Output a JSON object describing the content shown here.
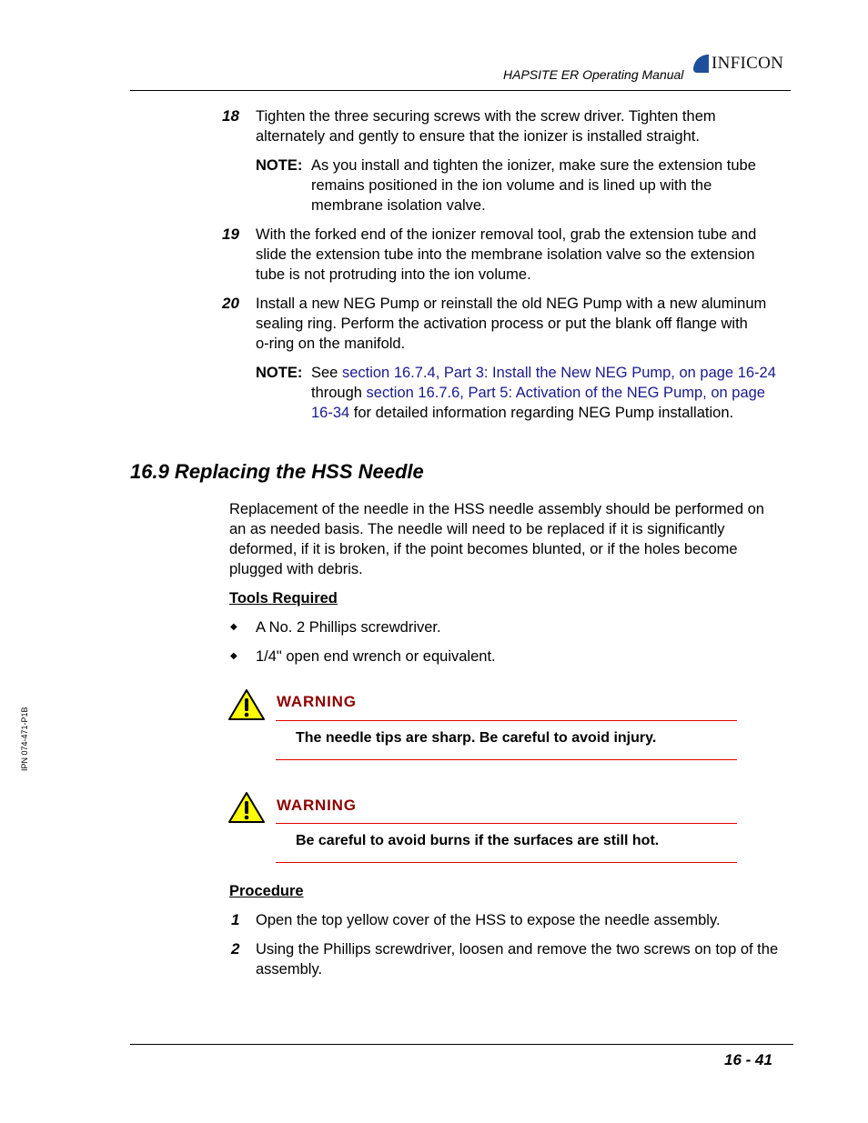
{
  "header": {
    "manual_title": "HAPSITE ER Operating Manual",
    "logo_text": "INFICON"
  },
  "steps_top": [
    {
      "number": "18",
      "lines": [
        "Tighten the three securing screws with the screw driver. Tighten them",
        "alternately and gently to ensure that the ionizer is installed straight."
      ],
      "note": {
        "label": "NOTE:",
        "lines": [
          "As you install and tighten the ionizer, make sure the extension tube",
          "remains positioned in the ion volume and is lined up with the",
          "membrane isolation valve."
        ]
      }
    },
    {
      "number": "19",
      "lines": [
        "With the forked end of the ionizer removal tool, grab the extension tube and",
        "slide the extension tube into the membrane isolation valve so the extension",
        "tube is not protruding into the ion volume."
      ]
    },
    {
      "number": "20",
      "lines": [
        "Install a new NEG Pump or reinstall the old NEG Pump with a new aluminum",
        "sealing ring. Perform the activation process or put the blank off flange with",
        "o-ring on the manifold."
      ],
      "note": {
        "label": "NOTE:",
        "line1_prefix": "See ",
        "link1": "section 16.7.4, Part 3: Install the New NEG Pump, on page 16-24",
        "line2_prefix": "through ",
        "link2_part1": "section 16.7.6, Part 5: Activation of the NEG Pump, on page",
        "link2_part2": "16-34",
        "line3_suffix": " for detailed information regarding NEG Pump installation."
      }
    }
  ],
  "section": {
    "heading": "16.9  Replacing the HSS Needle",
    "intro_lines": [
      "Replacement of the needle in the HSS needle assembly should be performed on",
      "an as needed basis. The needle will need to be replaced if it is significantly",
      "deformed, if it is broken, if the point becomes blunted, or if the holes become",
      "plugged with debris."
    ],
    "tools_heading": "Tools Required",
    "tools": [
      "A No. 2 Phillips screwdriver.",
      "1/4\" open end wrench or equivalent."
    ],
    "bullet_glyph": "◆",
    "warnings": [
      {
        "title": "WARNING",
        "text": "The needle tips are sharp. Be careful to avoid injury."
      },
      {
        "title": "WARNING",
        "text": "Be careful to avoid burns if the surfaces are still hot."
      }
    ],
    "procedure_heading": "Procedure",
    "procedure_steps": [
      {
        "number": "1",
        "lines": [
          "Open the top yellow cover of the HSS to expose the needle assembly."
        ]
      },
      {
        "number": "2",
        "lines": [
          "Using the Phillips screwdriver, loosen and remove the two screws on top of the",
          "assembly."
        ]
      }
    ]
  },
  "sidebar": {
    "doc_id": "IPN 074-471-P1B"
  },
  "footer": {
    "page_number": "16 - 41"
  },
  "colors": {
    "link": "#1a1a8c",
    "warning_title": "#8b0000",
    "warning_rule": "#e00000",
    "warning_icon": "#ffff00"
  }
}
